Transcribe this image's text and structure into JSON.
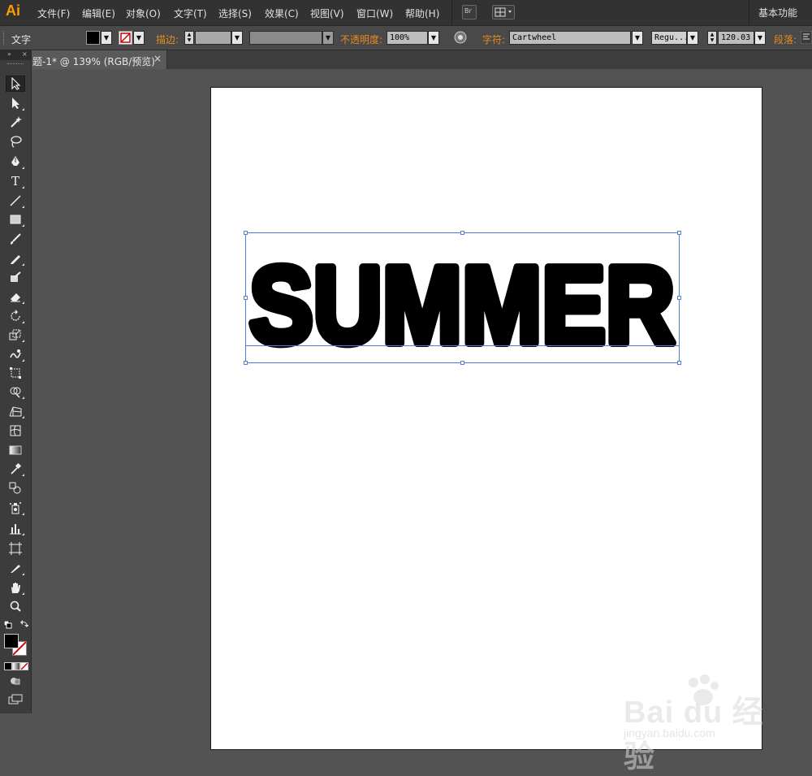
{
  "app": {
    "logo": "Ai"
  },
  "menu": [
    "文件(F)",
    "编辑(E)",
    "对象(O)",
    "文字(T)",
    "选择(S)",
    "效果(C)",
    "视图(V)",
    "窗口(W)",
    "帮助(H)"
  ],
  "topbar": {
    "bridge_label": "Br",
    "workspace": "基本功能"
  },
  "control": {
    "tool_label": "文字",
    "stroke_label": "描边:",
    "opacity_label": "不透明度:",
    "opacity_value": "100%",
    "char_label": "字符:",
    "font_name": "Cartwheel",
    "font_style": "Regu...",
    "font_size": "120.03",
    "para_label": "段落:"
  },
  "document": {
    "tab_title": "题-1* @ 139% (RGB/预览)",
    "close": "×"
  },
  "canvas": {
    "text": "SUMMER"
  },
  "watermark": {
    "brand": "Bai du 经验",
    "url": "jingyan.baidu.com"
  },
  "tools": [
    "selection",
    "direct-selection",
    "magic-wand",
    "lasso",
    "pen",
    "type",
    "line",
    "rectangle",
    "paintbrush",
    "pencil",
    "blob-brush",
    "eraser",
    "rotate",
    "scale",
    "warp",
    "free-transform",
    "shape-builder",
    "perspective-grid",
    "mesh",
    "gradient",
    "eyedropper",
    "blend",
    "symbol-sprayer",
    "column-graph",
    "artboard",
    "slice",
    "hand",
    "zoom"
  ],
  "colors": {
    "accent": "#ff9a00",
    "selection": "#4f7fd6",
    "label_orange": "#e88a1f"
  }
}
